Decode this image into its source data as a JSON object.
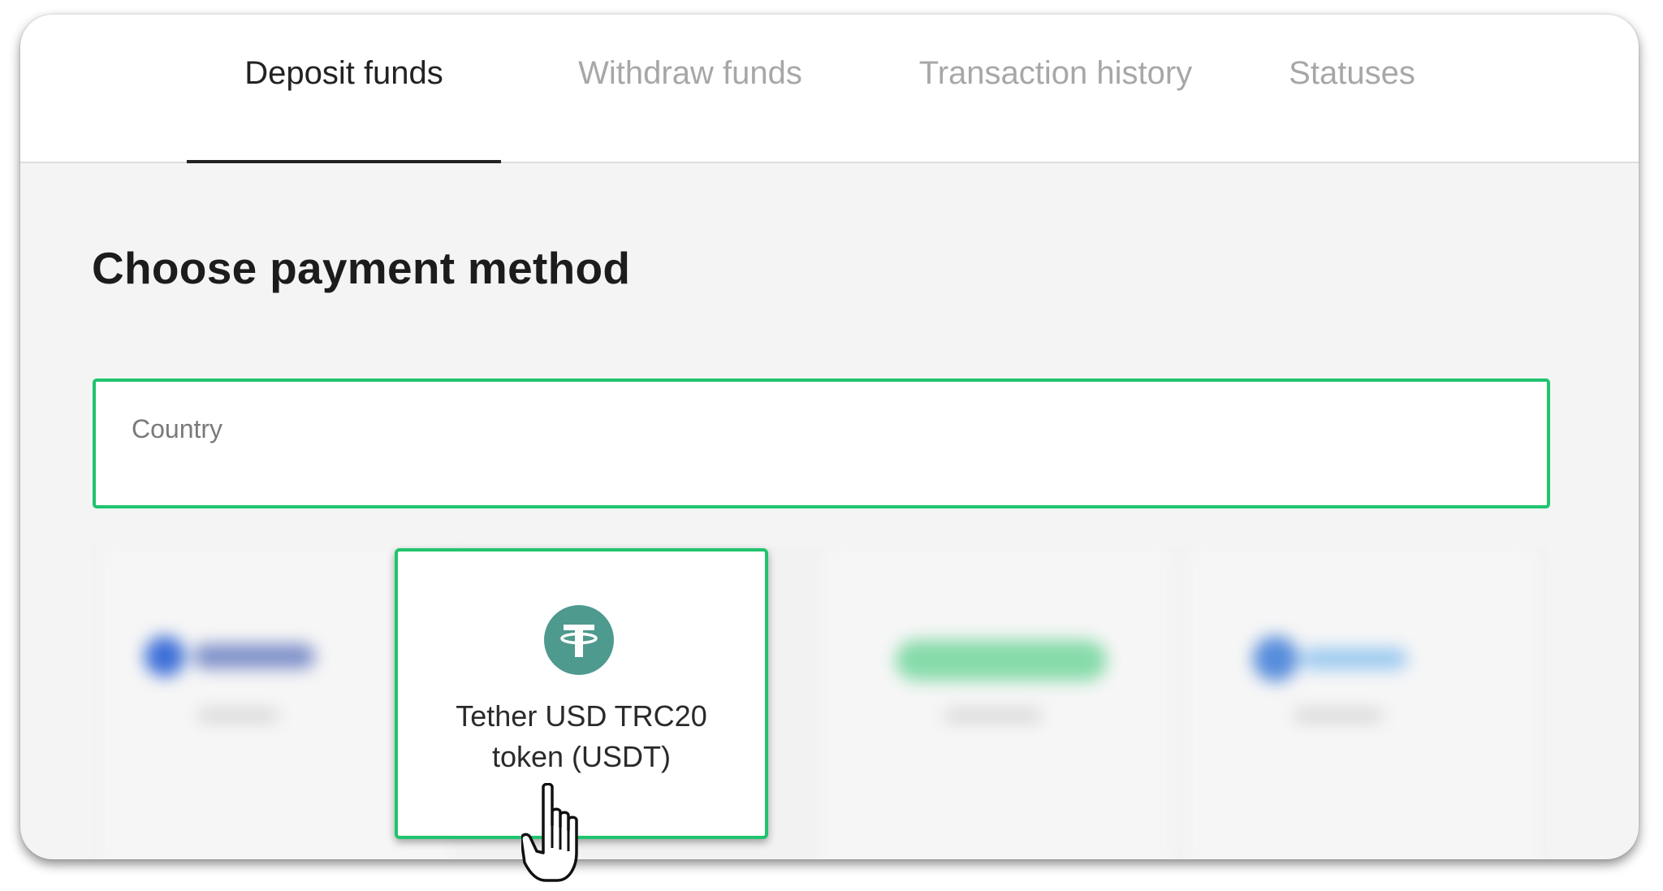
{
  "tabs": [
    {
      "label": "Deposit funds",
      "active": true
    },
    {
      "label": "Withdraw funds",
      "active": false
    },
    {
      "label": "Transaction history",
      "active": false
    },
    {
      "label": "Statuses",
      "active": false
    }
  ],
  "page_title": "Choose payment method",
  "country_field": {
    "label": "Country",
    "value": ""
  },
  "payment_methods": [
    {
      "name": "",
      "state": "blurred",
      "accent": "#3d6fd8"
    },
    {
      "name": "Tether USD TRC20 token (USDT)",
      "icon": "tether-icon",
      "state": "highlighted",
      "brand_color": "#4e9a8e"
    },
    {
      "name": "",
      "state": "blurred",
      "accent": "#29c46c"
    },
    {
      "name": "",
      "state": "blurred",
      "accent": "#2f73d6"
    }
  ],
  "colors": {
    "accent_green": "#20c46e",
    "active_tab_text": "#222222",
    "inactive_tab_text": "#a7a7a7",
    "content_background": "#f4f4f4"
  },
  "cursor": "hand-pointer-icon"
}
